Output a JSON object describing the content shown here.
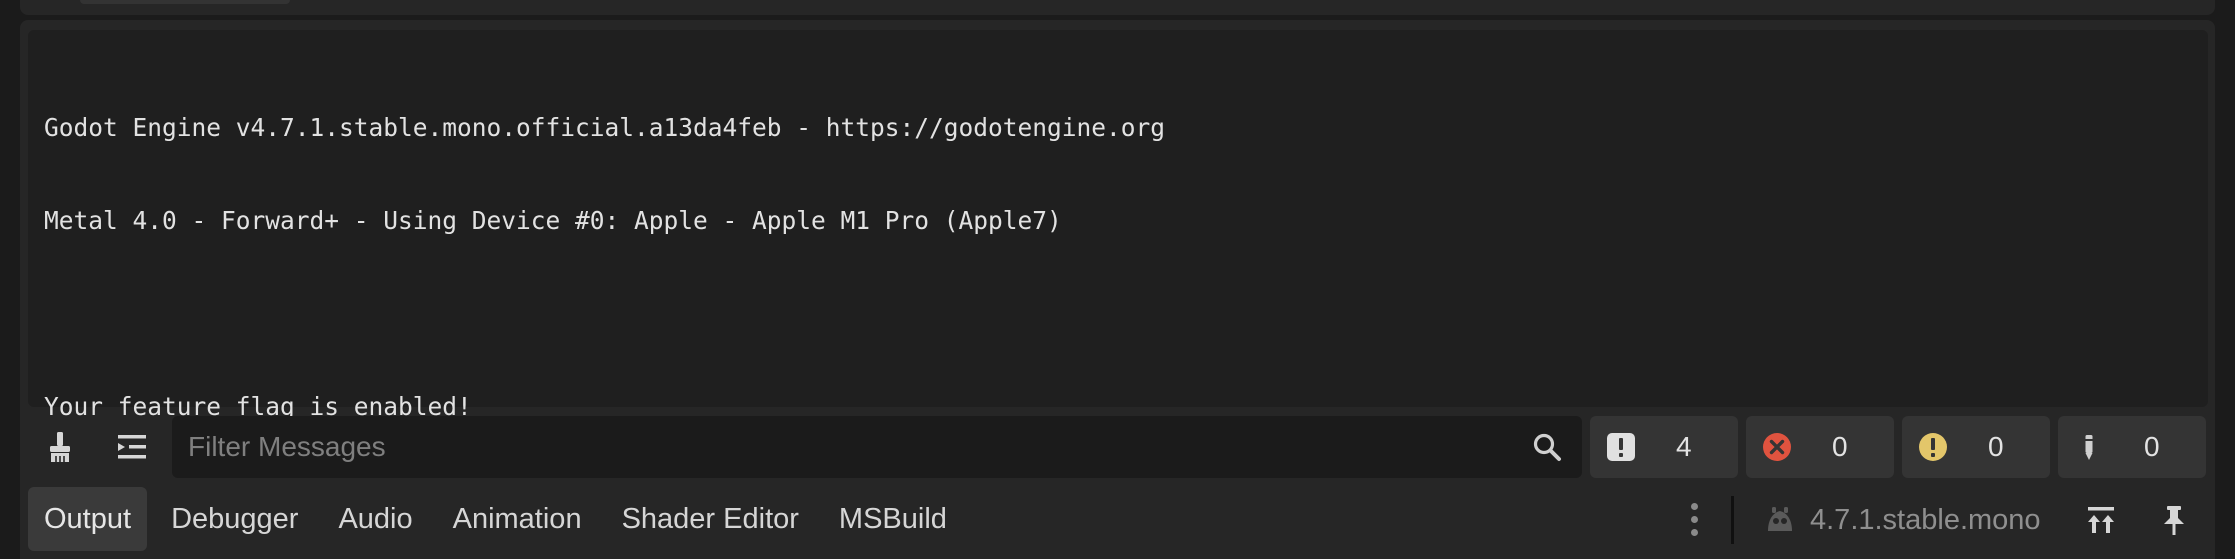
{
  "output_log": {
    "lines": [
      "Godot Engine v4.7.1.stable.mono.official.a13da4feb - https://godotengine.org",
      "Metal 4.0 - Forward+ - Using Device #0: Apple - Apple M1 Pro (Apple7)",
      "",
      "Your feature flag is enabled!"
    ]
  },
  "toolbar": {
    "clear_icon": "broom-icon",
    "collapse_icon": "collapse-lines-icon",
    "filter": {
      "placeholder": "Filter Messages",
      "value": ""
    },
    "counters": [
      {
        "name": "messages",
        "icon": "exclamation-square-icon",
        "value": "4",
        "color": "#e0e0e0"
      },
      {
        "name": "errors",
        "icon": "error-circle-icon",
        "value": "0",
        "color": "#e0533f"
      },
      {
        "name": "warnings",
        "icon": "warning-circle-icon",
        "value": "0",
        "color": "#e3c66a"
      },
      {
        "name": "editor",
        "icon": "pencil-icon",
        "value": "0",
        "color": "#d0d0d0"
      }
    ]
  },
  "tabs": [
    {
      "label": "Output",
      "active": true
    },
    {
      "label": "Debugger",
      "active": false
    },
    {
      "label": "Audio",
      "active": false
    },
    {
      "label": "Animation",
      "active": false
    },
    {
      "label": "Shader Editor",
      "active": false
    },
    {
      "label": "MSBuild",
      "active": false
    }
  ],
  "status": {
    "version": "4.7.1.stable.mono"
  },
  "colors": {
    "panel": "#262626",
    "log_background": "#1f1f1f",
    "active_tab": "#3a3a3a",
    "error": "#e0533f",
    "warning": "#e3c66a"
  }
}
